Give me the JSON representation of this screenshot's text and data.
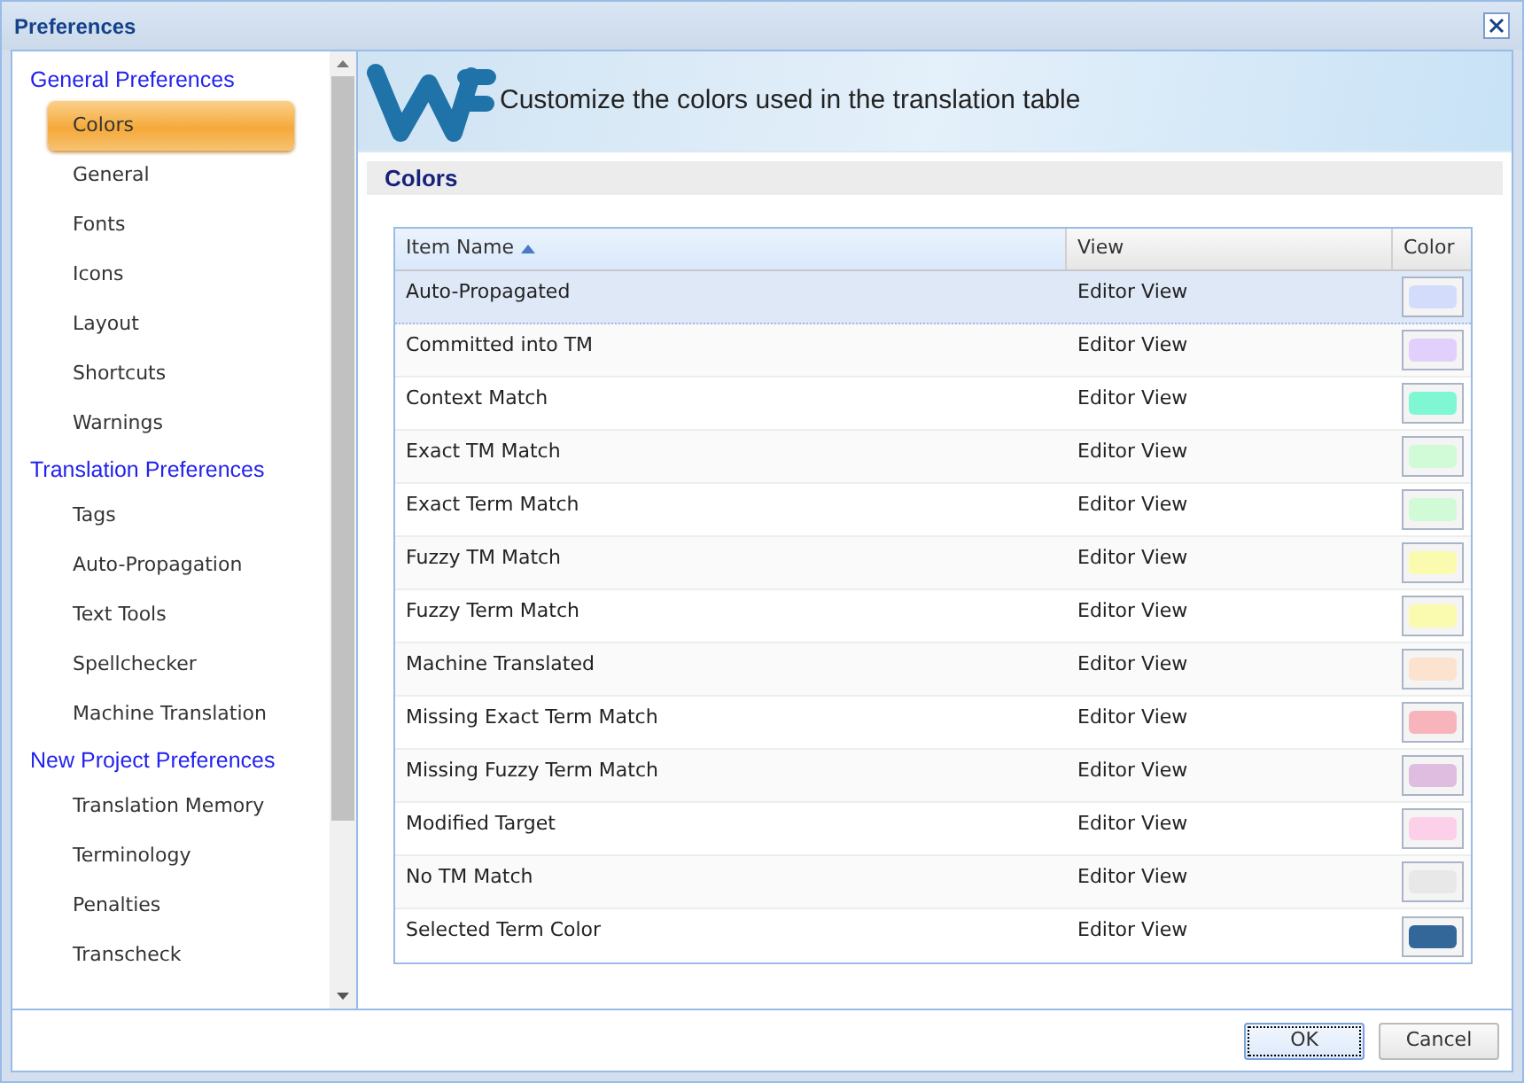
{
  "window": {
    "title": "Preferences"
  },
  "sidebar": {
    "sections": [
      {
        "label": "General Preferences",
        "items": [
          {
            "label": "Colors",
            "selected": true
          },
          {
            "label": "General",
            "selected": false
          },
          {
            "label": "Fonts",
            "selected": false
          },
          {
            "label": "Icons",
            "selected": false
          },
          {
            "label": "Layout",
            "selected": false
          },
          {
            "label": "Shortcuts",
            "selected": false
          },
          {
            "label": "Warnings",
            "selected": false
          }
        ]
      },
      {
        "label": "Translation Preferences",
        "items": [
          {
            "label": "Tags",
            "selected": false
          },
          {
            "label": "Auto-Propagation",
            "selected": false
          },
          {
            "label": "Text Tools",
            "selected": false
          },
          {
            "label": "Spellchecker",
            "selected": false
          },
          {
            "label": "Machine Translation",
            "selected": false
          }
        ]
      },
      {
        "label": "New Project Preferences",
        "items": [
          {
            "label": "Translation Memory",
            "selected": false
          },
          {
            "label": "Terminology",
            "selected": false
          },
          {
            "label": "Penalties",
            "selected": false
          },
          {
            "label": "Transcheck",
            "selected": false
          }
        ]
      }
    ]
  },
  "banner": {
    "text": "Customize the colors used in the translation table"
  },
  "section_title": "Colors",
  "table": {
    "columns": [
      {
        "label": "Item Name",
        "sorted": true
      },
      {
        "label": "View",
        "sorted": false
      },
      {
        "label": "Color",
        "sorted": false
      }
    ],
    "rows": [
      {
        "name": "Auto-Propagated",
        "view": "Editor View",
        "color": "#d3dcfb",
        "selected": true
      },
      {
        "name": "Committed into TM",
        "view": "Editor View",
        "color": "#e0d0fb",
        "selected": false
      },
      {
        "name": "Context Match",
        "view": "Editor View",
        "color": "#80f7d3",
        "selected": false
      },
      {
        "name": "Exact TM Match",
        "view": "Editor View",
        "color": "#d0fbd6",
        "selected": false
      },
      {
        "name": "Exact Term Match",
        "view": "Editor View",
        "color": "#d0fbd6",
        "selected": false
      },
      {
        "name": "Fuzzy TM Match",
        "view": "Editor View",
        "color": "#fbfbb0",
        "selected": false
      },
      {
        "name": "Fuzzy Term Match",
        "view": "Editor View",
        "color": "#fbfbb0",
        "selected": false
      },
      {
        "name": "Machine Translated",
        "view": "Editor View",
        "color": "#fbe3cf",
        "selected": false
      },
      {
        "name": "Missing Exact Term Match",
        "view": "Editor View",
        "color": "#f7b5bb",
        "selected": false
      },
      {
        "name": "Missing Fuzzy Term Match",
        "view": "Editor View",
        "color": "#dfbde0",
        "selected": false
      },
      {
        "name": "Modified Target",
        "view": "Editor View",
        "color": "#fbd0e8",
        "selected": false
      },
      {
        "name": "No TM Match",
        "view": "Editor View",
        "color": "#e8e8e8",
        "selected": false
      },
      {
        "name": "Selected Term Color",
        "view": "Editor View",
        "color": "#336699",
        "selected": false
      }
    ]
  },
  "buttons": [
    {
      "label": "OK",
      "kind": "primary"
    },
    {
      "label": "Cancel",
      "kind": "secondary"
    }
  ]
}
